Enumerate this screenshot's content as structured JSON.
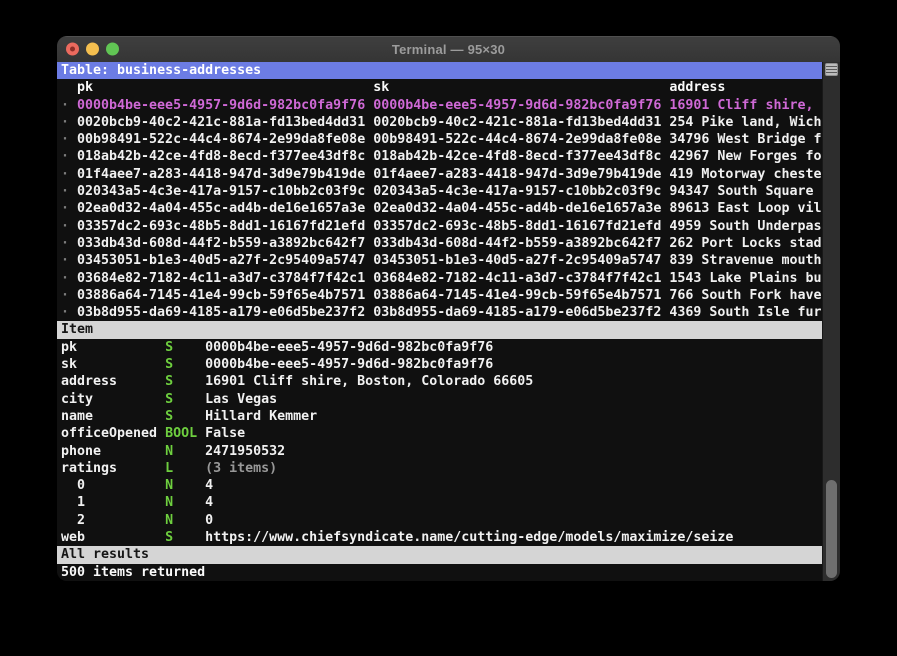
{
  "window": {
    "title": "Terminal — 95×30"
  },
  "colors": {
    "table_header_bg": "#6c7ce4",
    "selected_row_text": "#cf69d6",
    "type_badge": "#6ecf3f",
    "muted_value": "#989898",
    "section_bar_bg": "#d5d5d5",
    "terminal_bg": "#101010",
    "traffic_red": "#ec6a5e",
    "traffic_yellow": "#f5bf4f",
    "traffic_green": "#61c554"
  },
  "table_view": {
    "header": "Table: business-addresses",
    "bullet": "·",
    "columns": [
      "pk",
      "sk",
      "address"
    ],
    "rows": [
      {
        "pk": "0000b4be-eee5-4957-9d6d-982bc0fa9f76",
        "sk": "0000b4be-eee5-4957-9d6d-982bc0fa9f76",
        "address": "16901 Cliff shire, ",
        "selected": true
      },
      {
        "pk": "0020bcb9-40c2-421c-881a-fd13bed4dd31",
        "sk": "0020bcb9-40c2-421c-881a-fd13bed4dd31",
        "address": "254 Pike land, Wich",
        "selected": false
      },
      {
        "pk": "00b98491-522c-44c4-8674-2e99da8fe08e",
        "sk": "00b98491-522c-44c4-8674-2e99da8fe08e",
        "address": "34796 West Bridge f",
        "selected": false
      },
      {
        "pk": "018ab42b-42ce-4fd8-8ecd-f377ee43df8c",
        "sk": "018ab42b-42ce-4fd8-8ecd-f377ee43df8c",
        "address": "42967 New Forges fo",
        "selected": false
      },
      {
        "pk": "01f4aee7-a283-4418-947d-3d9e79b419de",
        "sk": "01f4aee7-a283-4418-947d-3d9e79b419de",
        "address": "419 Motorway cheste",
        "selected": false
      },
      {
        "pk": "020343a5-4c3e-417a-9157-c10bb2c03f9c",
        "sk": "020343a5-4c3e-417a-9157-c10bb2c03f9c",
        "address": "94347 South Square ",
        "selected": false
      },
      {
        "pk": "02ea0d32-4a04-455c-ad4b-de16e1657a3e",
        "sk": "02ea0d32-4a04-455c-ad4b-de16e1657a3e",
        "address": "89613 East Loop vil",
        "selected": false
      },
      {
        "pk": "03357dc2-693c-48b5-8dd1-16167fd21efd",
        "sk": "03357dc2-693c-48b5-8dd1-16167fd21efd",
        "address": "4959 South Underpas",
        "selected": false
      },
      {
        "pk": "033db43d-608d-44f2-b559-a3892bc642f7",
        "sk": "033db43d-608d-44f2-b559-a3892bc642f7",
        "address": "262 Port Locks stad",
        "selected": false
      },
      {
        "pk": "03453051-b1e3-40d5-a27f-2c95409a5747",
        "sk": "03453051-b1e3-40d5-a27f-2c95409a5747",
        "address": "839 Stravenue mouth",
        "selected": false
      },
      {
        "pk": "03684e82-7182-4c11-a3d7-c3784f7f42c1",
        "sk": "03684e82-7182-4c11-a3d7-c3784f7f42c1",
        "address": "1543 Lake Plains bu",
        "selected": false
      },
      {
        "pk": "03886a64-7145-41e4-99cb-59f65e4b7571",
        "sk": "03886a64-7145-41e4-99cb-59f65e4b7571",
        "address": "766 South Fork have",
        "selected": false
      },
      {
        "pk": "03b8d955-da69-4185-a179-e06d5be237f2",
        "sk": "03b8d955-da69-4185-a179-e06d5be237f2",
        "address": "4369 South Isle fur",
        "selected": false
      }
    ]
  },
  "item_view": {
    "header": "Item",
    "fields": [
      {
        "key": "pk",
        "type": "S",
        "value": "0000b4be-eee5-4957-9d6d-982bc0fa9f76",
        "muted": false
      },
      {
        "key": "sk",
        "type": "S",
        "value": "0000b4be-eee5-4957-9d6d-982bc0fa9f76",
        "muted": false
      },
      {
        "key": "address",
        "type": "S",
        "value": "16901 Cliff shire, Boston, Colorado 66605",
        "muted": false
      },
      {
        "key": "city",
        "type": "S",
        "value": "Las Vegas",
        "muted": false
      },
      {
        "key": "name",
        "type": "S",
        "value": "Hillard Kemmer",
        "muted": false
      },
      {
        "key": "officeOpened",
        "type": "BOOL",
        "value": "False",
        "muted": false
      },
      {
        "key": "phone",
        "type": "N",
        "value": "2471950532",
        "muted": false
      },
      {
        "key": "ratings",
        "type": "L",
        "value": "(3 items)",
        "muted": true
      },
      {
        "key": "  0",
        "type": "N",
        "value": "4",
        "muted": false
      },
      {
        "key": "  1",
        "type": "N",
        "value": "4",
        "muted": false
      },
      {
        "key": "  2",
        "type": "N",
        "value": "0",
        "muted": false
      },
      {
        "key": "web",
        "type": "S",
        "value": "https://www.chiefsyndicate.name/cutting-edge/models/maximize/seize",
        "muted": false
      }
    ]
  },
  "footer": {
    "results_bar": "All results",
    "status": "500 items returned"
  }
}
